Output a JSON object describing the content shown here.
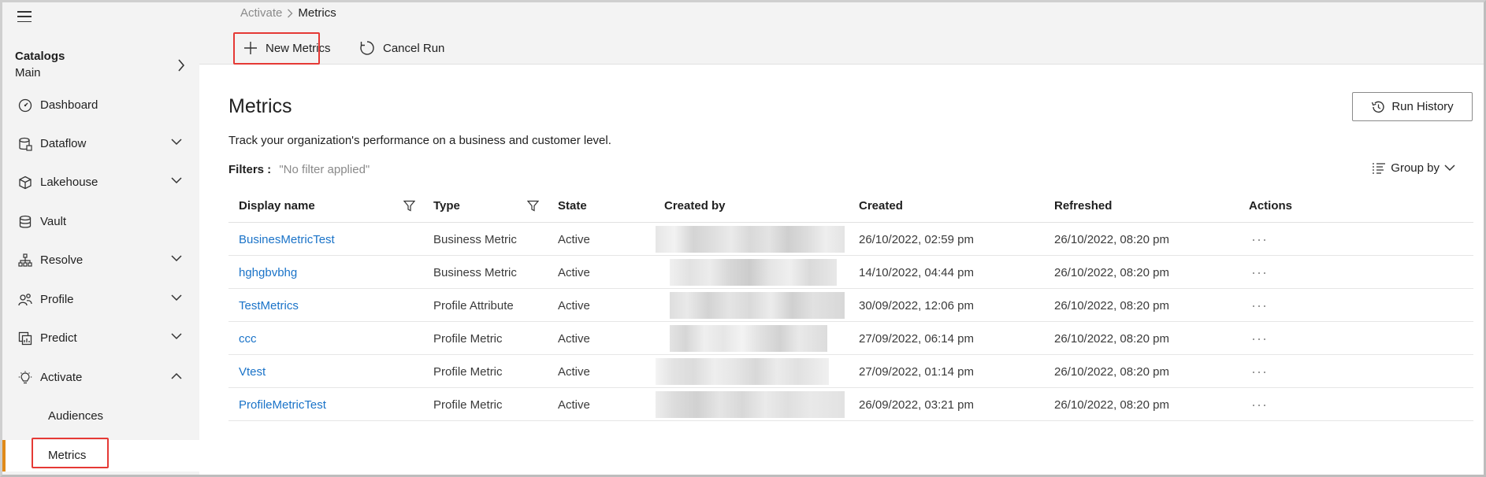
{
  "sidebar": {
    "catalogs_title": "Catalogs",
    "catalogs_value": "Main",
    "items": [
      {
        "label": "Dashboard",
        "icon": "gauge-icon",
        "expandable": false
      },
      {
        "label": "Dataflow",
        "icon": "database-flow-icon",
        "expandable": true
      },
      {
        "label": "Lakehouse",
        "icon": "cube-icon",
        "expandable": true
      },
      {
        "label": "Vault",
        "icon": "database-icon",
        "expandable": false
      },
      {
        "label": "Resolve",
        "icon": "hierarchy-icon",
        "expandable": true
      },
      {
        "label": "Profile",
        "icon": "people-icon",
        "expandable": true
      },
      {
        "label": "Predict",
        "icon": "chart-doc-icon",
        "expandable": true
      },
      {
        "label": "Activate",
        "icon": "lightbulb-icon",
        "expandable": true,
        "expanded": true
      }
    ],
    "sub_items": [
      "Audiences",
      "Metrics"
    ],
    "accent_color": "#e08a1a"
  },
  "breadcrumb": {
    "parent": "Activate",
    "current": "Metrics"
  },
  "toolbar": {
    "new_metrics": "New Metrics",
    "cancel_run": "Cancel Run"
  },
  "page": {
    "title": "Metrics",
    "subtitle": "Track your organization's performance on a business and customer level.",
    "filters_label": "Filters :",
    "filters_value": "\"No filter applied\"",
    "run_history": "Run History",
    "group_by": "Group by"
  },
  "table": {
    "columns": [
      "Display name",
      "Type",
      "State",
      "Created by",
      "Created",
      "Refreshed",
      "Actions"
    ],
    "rows": [
      {
        "name": "BusinesMetricTest",
        "type": "Business Metric",
        "state": "Active",
        "created": "26/10/2022, 02:59 pm",
        "refreshed": "26/10/2022, 08:20 pm"
      },
      {
        "name": "hghgbvbhg",
        "type": "Business Metric",
        "state": "Active",
        "created": "14/10/2022, 04:44 pm",
        "refreshed": "26/10/2022, 08:20 pm"
      },
      {
        "name": "TestMetrics",
        "type": "Profile Attribute",
        "state": "Active",
        "created": "30/09/2022, 12:06 pm",
        "refreshed": "26/10/2022, 08:20 pm"
      },
      {
        "name": "ccc",
        "type": "Profile Metric",
        "state": "Active",
        "created": "27/09/2022, 06:14 pm",
        "refreshed": "26/10/2022, 08:20 pm"
      },
      {
        "name": "Vtest",
        "type": "Profile Metric",
        "state": "Active",
        "created": "27/09/2022, 01:14 pm",
        "refreshed": "26/10/2022, 08:20 pm"
      },
      {
        "name": "ProfileMetricTest",
        "type": "Profile Metric",
        "state": "Active",
        "created": "26/09/2022, 03:21 pm",
        "refreshed": "26/10/2022, 08:20 pm"
      }
    ],
    "actions_glyph": "···"
  },
  "colors": {
    "link": "#1a73c8",
    "highlight": "#e53935"
  }
}
